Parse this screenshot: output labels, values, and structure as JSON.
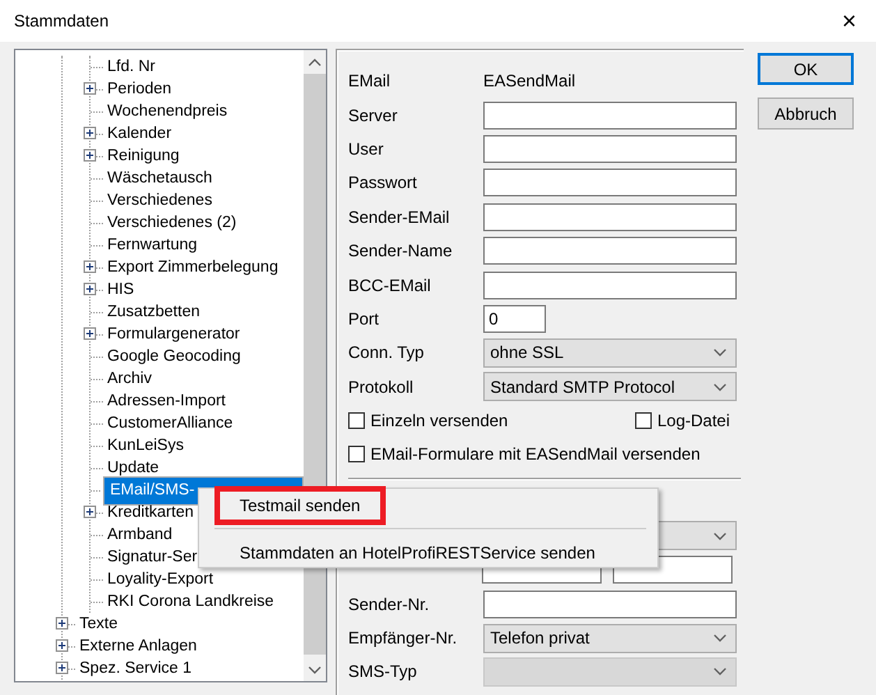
{
  "window": {
    "title": "Stammdaten",
    "close": "×"
  },
  "tree": {
    "hidden_parent_children": [
      {
        "label": "Lfd. Nr",
        "expandable": false,
        "selected": false
      },
      {
        "label": "Perioden",
        "expandable": true,
        "selected": false
      },
      {
        "label": "Wochenendpreis",
        "expandable": false,
        "selected": false
      },
      {
        "label": "Kalender",
        "expandable": true,
        "selected": false
      },
      {
        "label": "Reinigung",
        "expandable": true,
        "selected": false
      },
      {
        "label": "Wäschetausch",
        "expandable": false,
        "selected": false
      },
      {
        "label": "Verschiedenes",
        "expandable": false,
        "selected": false
      },
      {
        "label": "Verschiedenes (2)",
        "expandable": false,
        "selected": false
      },
      {
        "label": "Fernwartung",
        "expandable": false,
        "selected": false
      },
      {
        "label": "Export Zimmerbelegung",
        "expandable": true,
        "selected": false
      },
      {
        "label": "HIS",
        "expandable": true,
        "selected": false
      },
      {
        "label": "Zusatzbetten",
        "expandable": false,
        "selected": false
      },
      {
        "label": "Formulargenerator",
        "expandable": true,
        "selected": false
      },
      {
        "label": "Google Geocoding",
        "expandable": false,
        "selected": false
      },
      {
        "label": "Archiv",
        "expandable": false,
        "selected": false
      },
      {
        "label": "Adressen-Import",
        "expandable": false,
        "selected": false
      },
      {
        "label": "CustomerAlliance",
        "expandable": false,
        "selected": false
      },
      {
        "label": "KunLeiSys",
        "expandable": false,
        "selected": false
      },
      {
        "label": "Update",
        "expandable": false,
        "selected": false
      },
      {
        "label": "EMail/SMS-",
        "expandable": false,
        "selected": true
      },
      {
        "label": "Kreditkarten",
        "expandable": true,
        "selected": false
      },
      {
        "label": "Armband",
        "expandable": false,
        "selected": false
      },
      {
        "label": "Signatur-Ser",
        "expandable": false,
        "selected": false
      },
      {
        "label": "Loyality-Export",
        "expandable": false,
        "selected": false
      },
      {
        "label": "RKI Corona Landkreise",
        "expandable": false,
        "selected": false
      }
    ],
    "items": [
      {
        "label": "Texte",
        "expandable": true,
        "selected": false
      },
      {
        "label": "Externe Anlagen",
        "expandable": true,
        "selected": false
      },
      {
        "label": "Spez. Service 1",
        "expandable": true,
        "selected": false
      }
    ]
  },
  "email_section": [
    {
      "kind": "static",
      "label": "EMail",
      "value": "EASendMail"
    },
    {
      "kind": "text",
      "label": "Server"
    },
    {
      "kind": "text",
      "label": "User"
    },
    {
      "kind": "text",
      "label": "Passwort"
    },
    {
      "kind": "text",
      "label": "Sender-EMail"
    },
    {
      "kind": "text",
      "label": "Sender-Name"
    },
    {
      "kind": "text",
      "label": "BCC-EMail"
    },
    {
      "kind": "short",
      "label": "Port",
      "value": "0"
    },
    {
      "kind": "select",
      "label": "Conn. Typ",
      "value": "ohne SSL"
    },
    {
      "kind": "select",
      "label": "Protokoll",
      "value": "Standard SMTP Protocol"
    },
    {
      "kind": "checks",
      "items": [
        {
          "label": "Einzeln versenden",
          "checked": false
        },
        {
          "label": "Log-Datei",
          "checked": false
        }
      ]
    },
    {
      "kind": "checks",
      "items": [
        {
          "label": "EMail-Formulare mit EASendMail versenden",
          "checked": false
        }
      ]
    }
  ],
  "sms_section": [
    {
      "kind": "select"
    },
    {
      "kind": "pair"
    },
    {
      "kind": "text",
      "label": "Sender-Nr."
    },
    {
      "kind": "select",
      "label": "Empfänger-Nr.",
      "value": "Telefon privat"
    },
    {
      "kind": "select",
      "label": "SMS-Typ",
      "disabled": true
    }
  ],
  "buttons": [
    {
      "label": "OK",
      "default": true
    },
    {
      "label": "Abbruch",
      "default": false
    }
  ],
  "context_menu": [
    {
      "label": "Testmail senden",
      "annotated": true
    },
    {
      "label": "Stammdaten an HotelProfiRESTService senden",
      "annotated": false
    }
  ]
}
